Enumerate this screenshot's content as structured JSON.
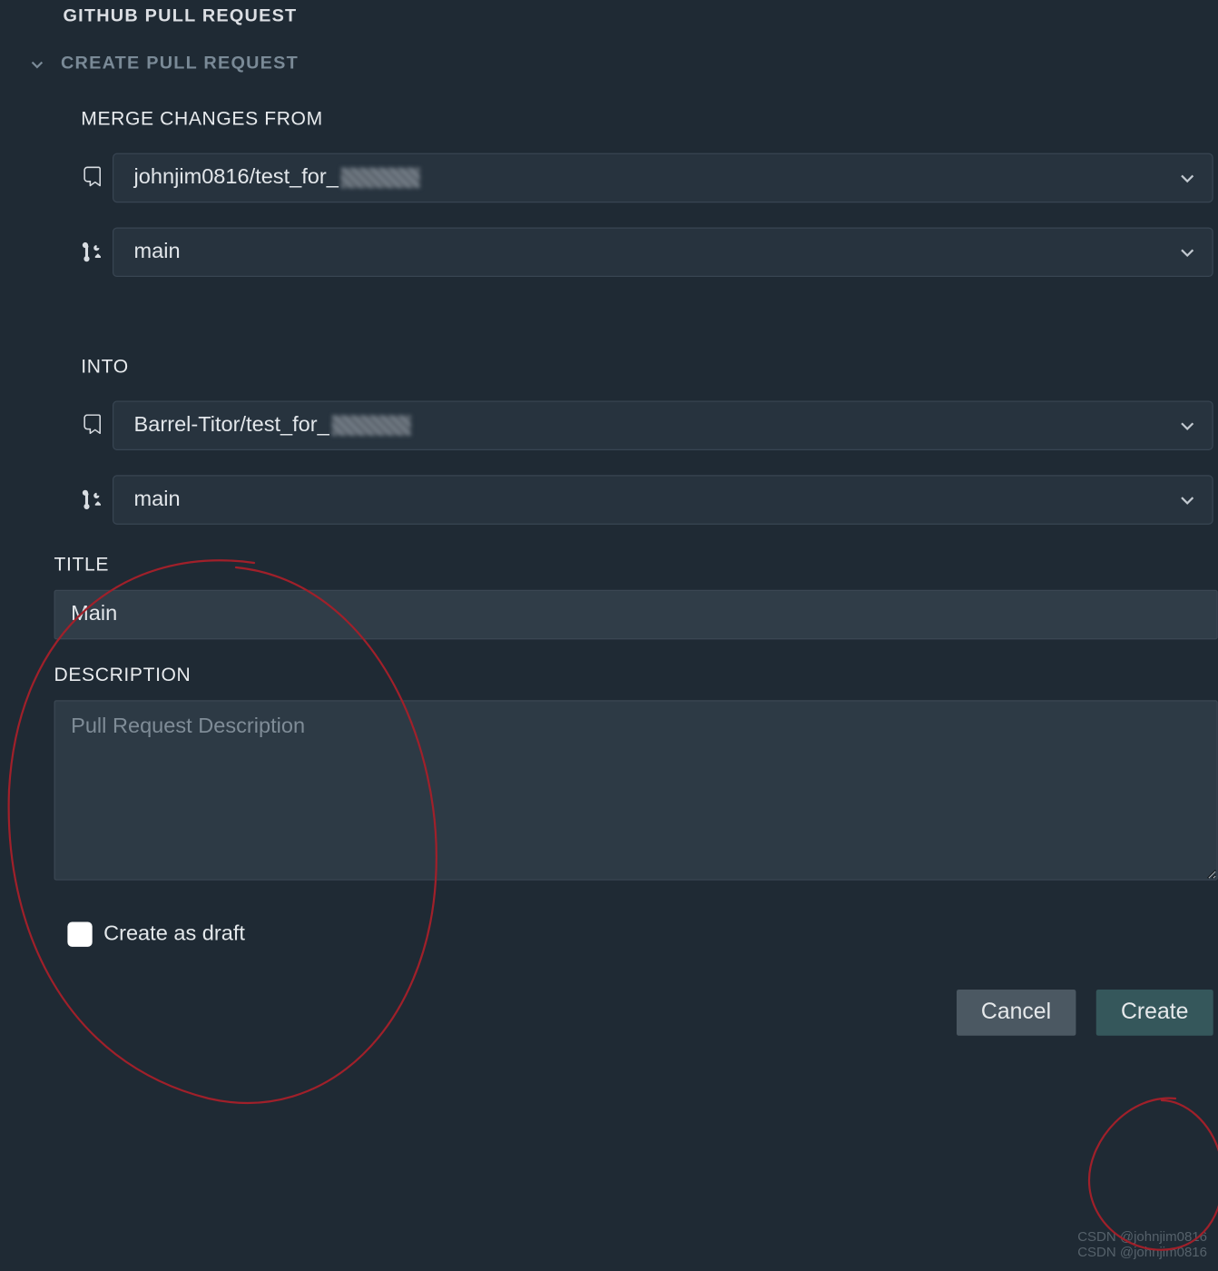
{
  "header": {
    "panel_title": "GITHUB PULL REQUEST",
    "section_title": "CREATE PULL REQUEST"
  },
  "merge_from": {
    "label": "MERGE CHANGES FROM",
    "repo": "johnjim0816/test_for_",
    "branch": "main"
  },
  "into": {
    "label": "INTO",
    "repo": "Barrel-Titor/test_for_",
    "branch": "main"
  },
  "title": {
    "label": "TITLE",
    "value": "Main"
  },
  "description": {
    "label": "DESCRIPTION",
    "placeholder": "Pull Request Description",
    "value": ""
  },
  "draft": {
    "label": "Create as draft",
    "checked": false
  },
  "buttons": {
    "cancel": "Cancel",
    "create": "Create"
  },
  "watermark": "CSDN @johnjim0816"
}
